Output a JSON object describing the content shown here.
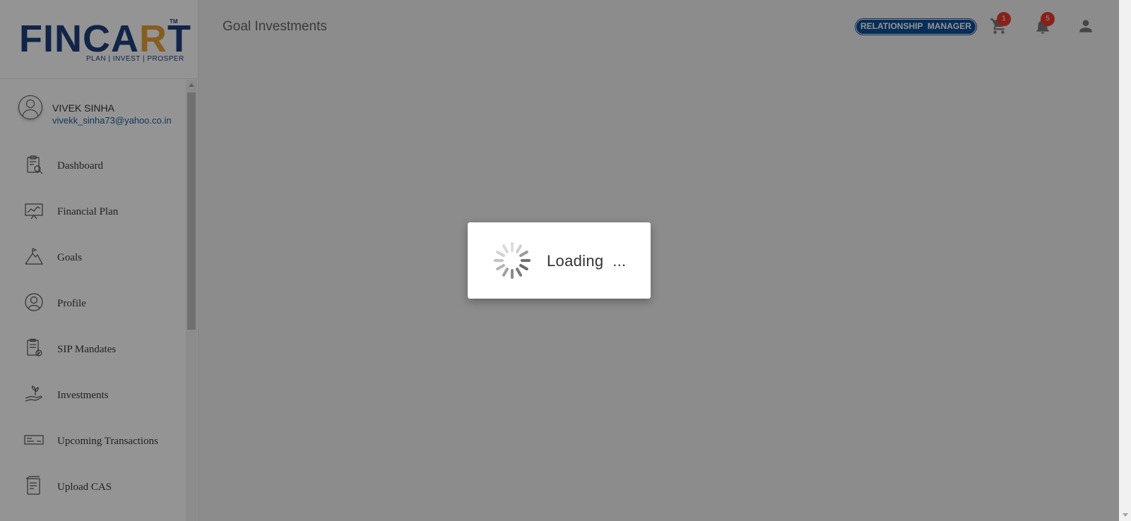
{
  "brand": {
    "name_part1": "FINCA",
    "name_accent": "R",
    "name_part2": "T",
    "trademark": "TM",
    "tagline": "PLAN | INVEST | PROSPER",
    "primary_color": "#1f3f7a",
    "accent_color": "#e8a33a"
  },
  "user": {
    "name": "VIVEK SINHA",
    "email": "vivekk_sinha73@yahoo.co.in",
    "icon": "user-avatar-icon"
  },
  "sidebar": {
    "items": [
      {
        "label": "Dashboard",
        "icon": "dashboard-clipboard-icon"
      },
      {
        "label": "Financial Plan",
        "icon": "chart-board-icon"
      },
      {
        "label": "Goals",
        "icon": "mountain-flag-icon"
      },
      {
        "label": "Profile",
        "icon": "profile-person-icon"
      },
      {
        "label": "SIP Mandates",
        "icon": "mandate-document-icon"
      },
      {
        "label": "Investments",
        "icon": "hand-plant-icon"
      },
      {
        "label": "Upcoming Transactions",
        "icon": "cheque-icon"
      },
      {
        "label": "Upload CAS",
        "icon": "upload-document-icon"
      }
    ]
  },
  "header": {
    "title": "Goal Investments",
    "rm_label": "RELATIONSHIP  MANAGER",
    "cart_count": "1",
    "notification_count": "5",
    "badge_color": "#e8392b",
    "rm_color": "#0d4f9a"
  },
  "loading": {
    "text": "Loading  ..."
  }
}
